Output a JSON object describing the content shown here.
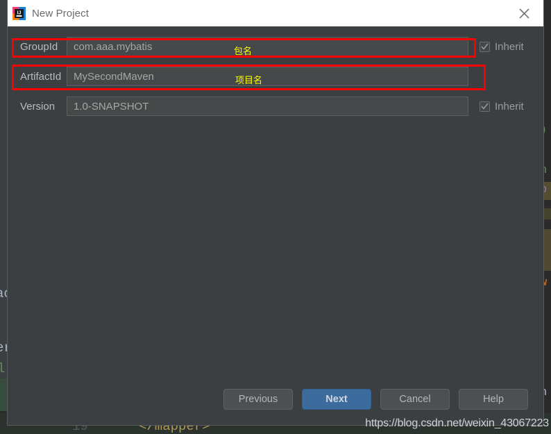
{
  "window": {
    "title": "New Project",
    "app_icon": "intellij-idea-icon",
    "close_icon": "close-icon"
  },
  "form": {
    "rows": [
      {
        "label": "GroupId",
        "value": "com.aaa.mybatis",
        "inherit_label": "Inherit",
        "inherit_checked": true,
        "annotation": "包名"
      },
      {
        "label": "ArtifactId",
        "value": "MySecondMaven",
        "inherit_label": "",
        "inherit_checked": false,
        "annotation": "项目名"
      },
      {
        "label": "Version",
        "value": "1.0-SNAPSHOT",
        "inherit_label": "Inherit",
        "inherit_checked": true,
        "annotation": ""
      }
    ]
  },
  "buttons": {
    "previous": "Previous",
    "next": "Next",
    "cancel": "Cancel",
    "help": "Help"
  },
  "watermark": "https://blog.csdn.net/weixin_43067223",
  "background_ide": {
    "bottom_line_number": "19",
    "bottom_code": "</mapper>",
    "left_fragments": [
      "ac",
      "er",
      "l"
    ]
  },
  "colors": {
    "accent_button": "#3c6b9e",
    "annotation_box": "#ff0000",
    "annotation_text": "#ffff00",
    "dialog_bg": "#3c3f41",
    "titlebar_bg": "#ffffff"
  }
}
